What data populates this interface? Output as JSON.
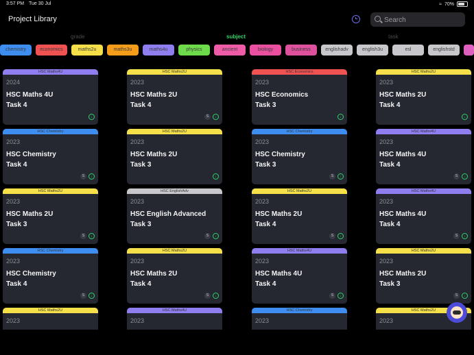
{
  "status": {
    "time": "3:57 PM",
    "date": "Tue 30 Jul",
    "battery": "70%"
  },
  "header": {
    "title": "Project Library",
    "search_placeholder": "Search"
  },
  "segments": {
    "grade": "grade",
    "subject": "subject",
    "task": "task"
  },
  "chips": [
    {
      "label": "chemistry",
      "color": "#3d8ef0"
    },
    {
      "label": "economics",
      "color": "#f05252"
    },
    {
      "label": "maths2u",
      "color": "#f5e04a"
    },
    {
      "label": "maths3u",
      "color": "#f59c1a"
    },
    {
      "label": "maths4u",
      "color": "#8e7ef0"
    },
    {
      "label": "physics",
      "color": "#6edb4a"
    },
    {
      "label": "ancient",
      "color": "#ee5ca8"
    },
    {
      "label": "biology",
      "color": "#ea4fa0"
    },
    {
      "label": "business",
      "color": "#e0519d"
    },
    {
      "label": "englishadv",
      "color": "#c8c8cc"
    },
    {
      "label": "english3u",
      "color": "#c8c8cc"
    },
    {
      "label": "esl",
      "color": "#c8c8cc"
    },
    {
      "label": "englishstd",
      "color": "#c8c8cc"
    },
    {
      "label": "",
      "color": "#e060c0"
    }
  ],
  "cards": [
    {
      "tag": "HSC Maths4U",
      "tagColor": "#8e7ef0",
      "year": "2024",
      "name": "HSC Maths 4U",
      "task": "Task 4",
      "s": false
    },
    {
      "tag": "HSC Maths2U",
      "tagColor": "#f5e04a",
      "year": "2023",
      "name": "HSC Maths 2U",
      "task": "Task 4",
      "s": true
    },
    {
      "tag": "HSC Economics",
      "tagColor": "#f05252",
      "year": "2023",
      "name": "HSC Economics",
      "task": "Task 3",
      "s": false
    },
    {
      "tag": "HSC Maths2U",
      "tagColor": "#f5e04a",
      "year": "2023",
      "name": "HSC Maths 2U",
      "task": "Task 4",
      "s": false
    },
    {
      "tag": "HSC Chemistry",
      "tagColor": "#3d8ef0",
      "year": "2023",
      "name": "HSC Chemistry",
      "task": "Task 4",
      "s": true
    },
    {
      "tag": "HSC Maths2U",
      "tagColor": "#f5e04a",
      "year": "2023",
      "name": "HSC Maths 2U",
      "task": "Task 3",
      "s": false
    },
    {
      "tag": "HSC Chemistry",
      "tagColor": "#3d8ef0",
      "year": "2023",
      "name": "HSC Chemistry",
      "task": "Task 3",
      "s": true
    },
    {
      "tag": "HSC Maths4U",
      "tagColor": "#8e7ef0",
      "year": "2023",
      "name": "HSC Maths 4U",
      "task": "Task 4",
      "s": true
    },
    {
      "tag": "HSC Maths2U",
      "tagColor": "#f5e04a",
      "year": "2023",
      "name": "HSC Maths 2U",
      "task": "Task 3",
      "s": true
    },
    {
      "tag": "HSC EnglishAdv",
      "tagColor": "#c8c8cc",
      "year": "2023",
      "name": "HSC English Advanced",
      "task": "Task 3",
      "s": true
    },
    {
      "tag": "HSC Maths2U",
      "tagColor": "#f5e04a",
      "year": "2023",
      "name": "HSC Maths 2U",
      "task": "Task 4",
      "s": true
    },
    {
      "tag": "HSC Maths4U",
      "tagColor": "#8e7ef0",
      "year": "2023",
      "name": "HSC Maths 4U",
      "task": "Task 4",
      "s": true
    },
    {
      "tag": "HSC Chemistry",
      "tagColor": "#3d8ef0",
      "year": "2023",
      "name": "HSC Chemistry",
      "task": "Task 4",
      "s": true
    },
    {
      "tag": "HSC Maths2U",
      "tagColor": "#f5e04a",
      "year": "2023",
      "name": "HSC Maths 2U",
      "task": "Task 4",
      "s": true
    },
    {
      "tag": "HSC Maths4U",
      "tagColor": "#8e7ef0",
      "year": "2023",
      "name": "HSC Maths 4U",
      "task": "Task 4",
      "s": true
    },
    {
      "tag": "HSC Maths2U",
      "tagColor": "#f5e04a",
      "year": "2023",
      "name": "HSC Maths 2U",
      "task": "Task 3",
      "s": true
    },
    {
      "tag": "HSC Maths2U",
      "tagColor": "#f5e04a",
      "year": "2023",
      "name": "",
      "task": "",
      "s": false
    },
    {
      "tag": "HSC Maths4U",
      "tagColor": "#8e7ef0",
      "year": "2023",
      "name": "",
      "task": "",
      "s": false
    },
    {
      "tag": "HSC Chemistry",
      "tagColor": "#3d8ef0",
      "year": "2023",
      "name": "",
      "task": "",
      "s": false
    },
    {
      "tag": "HSC Maths2U",
      "tagColor": "#f5e04a",
      "year": "2023",
      "name": "",
      "task": "",
      "s": false
    }
  ]
}
